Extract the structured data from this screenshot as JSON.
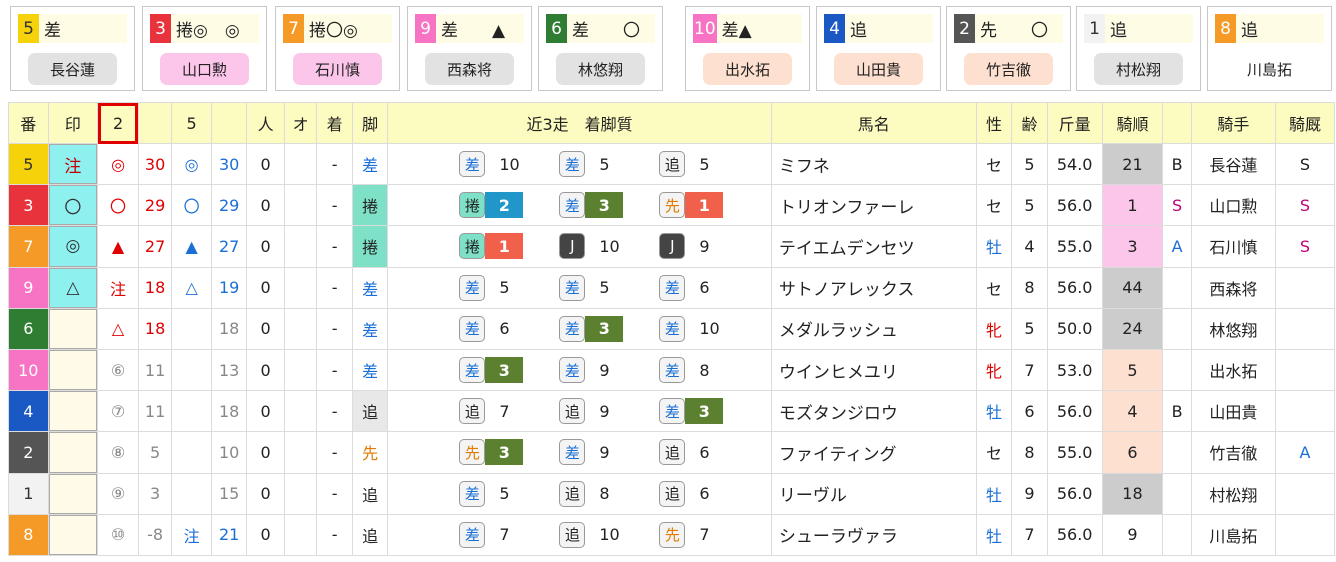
{
  "cards": [
    {
      "num": "5",
      "num_bg": "#f5d20a",
      "num_fg": "#333",
      "text": "差",
      "name": "長谷蓮",
      "name_bg": "#e2e2e2"
    },
    {
      "num": "3",
      "num_bg": "#e8333d",
      "num_fg": "#fff",
      "text": "捲◎　◎",
      "name": "山口勲",
      "name_bg": "#fcc6ea"
    },
    {
      "num": "7",
      "num_bg": "#f59a26",
      "num_fg": "#fff",
      "text": "捲〇◎",
      "name": "石川慎",
      "name_bg": "#fcc6ea"
    },
    {
      "num": "9",
      "num_bg": "#f774c4",
      "num_fg": "#fff",
      "text": "差　　▲",
      "name": "西森将",
      "name_bg": "#e2e2e2"
    },
    {
      "num": "6",
      "num_bg": "#2e7d32",
      "num_fg": "#fff",
      "text": "差　　〇",
      "name": "林悠翔",
      "name_bg": "#e2e2e2"
    },
    {
      "num": "10",
      "num_bg": "#f774c4",
      "num_fg": "#fff",
      "text": "差▲",
      "name": "出水拓",
      "name_bg": "#fde0cf"
    },
    {
      "num": "4",
      "num_bg": "#1a58c4",
      "num_fg": "#fff",
      "text": "追",
      "name": "山田貴",
      "name_bg": "#fde0cf"
    },
    {
      "num": "2",
      "num_bg": "#555555",
      "num_fg": "#fff",
      "text": "先　　〇",
      "name": "竹吉徹",
      "name_bg": "#fde0cf"
    },
    {
      "num": "1",
      "num_bg": "#f2f2f2",
      "num_fg": "#333",
      "text": "追",
      "name": "村松翔",
      "name_bg": "#e2e2e2"
    },
    {
      "num": "8",
      "num_bg": "#f59a26",
      "num_fg": "#fff",
      "text": "追",
      "name": "川島拓",
      "name_bg": "#ffffff"
    }
  ],
  "headers": [
    "番",
    "印",
    "2",
    "",
    "5",
    "",
    "人",
    "オ",
    "着",
    "脚",
    "近3走　着脚質",
    "馬名",
    "性",
    "齢",
    "斤量",
    "騎順",
    "",
    "騎手",
    "騎厩"
  ],
  "rows": [
    {
      "ban": "5",
      "ban_bg": "#f5d20a",
      "ban_fg": "#333",
      "mark": "注",
      "mark_style": "mark-cyan",
      "m2": "◎",
      "m2c": "c-red",
      "v2": "30",
      "v2c": "c-red",
      "m5": "◎",
      "m5c": "c-blue",
      "v5": "30",
      "v5c": "c-blue",
      "nin": "0",
      "o": "",
      "chaku": "-",
      "kyaku": "差",
      "kyaku_c": "c-blue",
      "kyaku_bg": "",
      "legs": [
        {
          "t": "差",
          "tc": "c-blue",
          "r": "10",
          "rbg": ""
        },
        {
          "t": "差",
          "tc": "c-blue",
          "r": "5",
          "rbg": ""
        },
        {
          "t": "追",
          "tc": "",
          "r": "5",
          "rbg": ""
        }
      ],
      "name": "ミフネ",
      "sex": "セ",
      "sexc": "",
      "age": "5",
      "kin": "54.0",
      "kijun": "21",
      "kijun_bg": "#cccccc",
      "rank": "B",
      "rankc": "",
      "kishu": "長谷蓮",
      "kyu": "S",
      "kyuc": ""
    },
    {
      "ban": "3",
      "ban_bg": "#e8333d",
      "ban_fg": "#fff",
      "mark": "〇",
      "mark_style": "mark-cyan",
      "m2": "〇",
      "m2c": "c-red",
      "v2": "29",
      "v2c": "c-red",
      "m5": "〇",
      "m5c": "c-blue",
      "v5": "29",
      "v5c": "c-blue",
      "nin": "0",
      "o": "",
      "chaku": "-",
      "kyaku": "捲",
      "kyaku_c": "",
      "kyaku_bg": "#7fe0c8",
      "legs": [
        {
          "t": "捲",
          "tc": "",
          "tbg": "#7fe0c8",
          "r": "2",
          "rbg": "#2196c8"
        },
        {
          "t": "差",
          "tc": "c-blue",
          "r": "3",
          "rbg": "#5a8030"
        },
        {
          "t": "先",
          "tc": "",
          "tcol": "#e07a00",
          "r": "1",
          "rbg": "#f0604a"
        }
      ],
      "name": "トリオンファーレ",
      "sex": "セ",
      "sexc": "",
      "age": "5",
      "kin": "56.0",
      "kijun": "1",
      "kijun_bg": "#fcc6ea",
      "rank": "S",
      "rankc": "c-mag",
      "kishu": "山口勲",
      "kyu": "S",
      "kyuc": "c-mag"
    },
    {
      "ban": "7",
      "ban_bg": "#f59a26",
      "ban_fg": "#fff",
      "mark": "◎",
      "mark_style": "mark-cyan",
      "m2": "▲",
      "m2c": "c-red",
      "v2": "27",
      "v2c": "c-red",
      "m5": "▲",
      "m5c": "c-blue",
      "v5": "27",
      "v5c": "c-blue",
      "nin": "0",
      "o": "",
      "chaku": "-",
      "kyaku": "捲",
      "kyaku_c": "",
      "kyaku_bg": "#7fe0c8",
      "legs": [
        {
          "t": "捲",
          "tc": "",
          "tbg": "#7fe0c8",
          "r": "1",
          "rbg": "#f0604a"
        },
        {
          "t": "J",
          "tc": "",
          "tbg": "#444",
          "tcol": "#fff",
          "r": "10",
          "rbg": ""
        },
        {
          "t": "J",
          "tc": "",
          "tbg": "#444",
          "tcol": "#fff",
          "r": "9",
          "rbg": ""
        }
      ],
      "name": "テイエムデンセツ",
      "sex": "牡",
      "sexc": "c-blue",
      "age": "4",
      "kin": "55.0",
      "kijun": "3",
      "kijun_bg": "#fcc6ea",
      "rank": "A",
      "rankc": "c-blue",
      "kishu": "石川慎",
      "kyu": "S",
      "kyuc": "c-mag"
    },
    {
      "ban": "9",
      "ban_bg": "#f774c4",
      "ban_fg": "#fff",
      "mark": "△",
      "mark_style": "mark-cyan",
      "m2": "注",
      "m2c": "c-red",
      "v2": "18",
      "v2c": "c-red",
      "m5": "△",
      "m5c": "c-blue",
      "v5": "19",
      "v5c": "c-blue",
      "nin": "0",
      "o": "",
      "chaku": "-",
      "kyaku": "差",
      "kyaku_c": "c-blue",
      "kyaku_bg": "",
      "legs": [
        {
          "t": "差",
          "tc": "c-blue",
          "r": "5",
          "rbg": ""
        },
        {
          "t": "差",
          "tc": "c-blue",
          "r": "5",
          "rbg": ""
        },
        {
          "t": "差",
          "tc": "c-blue",
          "r": "6",
          "rbg": ""
        }
      ],
      "name": "サトノアレックス",
      "sex": "セ",
      "sexc": "",
      "age": "8",
      "kin": "56.0",
      "kijun": "44",
      "kijun_bg": "#cccccc",
      "rank": "",
      "rankc": "",
      "kishu": "西森将",
      "kyu": "",
      "kyuc": ""
    },
    {
      "ban": "6",
      "ban_bg": "#2e7d32",
      "ban_fg": "#fff",
      "mark": "",
      "mark_style": "mark-cream",
      "m2": "△",
      "m2c": "c-red",
      "v2": "18",
      "v2c": "c-red",
      "m5": "",
      "m5c": "",
      "v5": "18",
      "v5c": "c-gray",
      "nin": "0",
      "o": "",
      "chaku": "-",
      "kyaku": "差",
      "kyaku_c": "c-blue",
      "kyaku_bg": "",
      "legs": [
        {
          "t": "差",
          "tc": "c-blue",
          "r": "6",
          "rbg": ""
        },
        {
          "t": "差",
          "tc": "c-blue",
          "r": "3",
          "rbg": "#5a8030"
        },
        {
          "t": "差",
          "tc": "c-blue",
          "r": "10",
          "rbg": ""
        }
      ],
      "name": "メダルラッシュ",
      "sex": "牝",
      "sexc": "c-red",
      "age": "5",
      "kin": "50.0",
      "kijun": "24",
      "kijun_bg": "#cccccc",
      "rank": "",
      "rankc": "",
      "kishu": "林悠翔",
      "kyu": "",
      "kyuc": ""
    },
    {
      "ban": "10",
      "ban_bg": "#f774c4",
      "ban_fg": "#fff",
      "mark": "",
      "mark_style": "mark-cream",
      "m2": "⑥",
      "m2c": "c-gray",
      "v2": "11",
      "v2c": "c-gray",
      "m5": "",
      "m5c": "",
      "v5": "13",
      "v5c": "c-gray",
      "nin": "0",
      "o": "",
      "chaku": "-",
      "kyaku": "差",
      "kyaku_c": "c-blue",
      "kyaku_bg": "",
      "legs": [
        {
          "t": "差",
          "tc": "c-blue",
          "r": "3",
          "rbg": "#5a8030"
        },
        {
          "t": "差",
          "tc": "c-blue",
          "r": "9",
          "rbg": ""
        },
        {
          "t": "差",
          "tc": "c-blue",
          "r": "8",
          "rbg": ""
        }
      ],
      "name": "ウインヒメユリ",
      "sex": "牝",
      "sexc": "c-red",
      "age": "7",
      "kin": "53.0",
      "kijun": "5",
      "kijun_bg": "#fde0cf",
      "rank": "",
      "rankc": "",
      "kishu": "出水拓",
      "kyu": "",
      "kyuc": ""
    },
    {
      "ban": "4",
      "ban_bg": "#1a58c4",
      "ban_fg": "#fff",
      "mark": "",
      "mark_style": "mark-cream",
      "m2": "⑦",
      "m2c": "c-gray",
      "v2": "11",
      "v2c": "c-gray",
      "m5": "",
      "m5c": "",
      "v5": "18",
      "v5c": "c-gray",
      "nin": "0",
      "o": "",
      "chaku": "-",
      "kyaku": "追",
      "kyaku_c": "",
      "kyaku_bg": "#e8e8e8",
      "legs": [
        {
          "t": "追",
          "tc": "",
          "r": "7",
          "rbg": ""
        },
        {
          "t": "追",
          "tc": "",
          "r": "9",
          "rbg": ""
        },
        {
          "t": "差",
          "tc": "c-blue",
          "r": "3",
          "rbg": "#5a8030"
        }
      ],
      "name": "モズタンジロウ",
      "sex": "牡",
      "sexc": "c-blue",
      "age": "6",
      "kin": "56.0",
      "kijun": "4",
      "kijun_bg": "#fde0cf",
      "rank": "B",
      "rankc": "",
      "kishu": "山田貴",
      "kyu": "",
      "kyuc": ""
    },
    {
      "ban": "2",
      "ban_bg": "#555555",
      "ban_fg": "#fff",
      "mark": "",
      "mark_style": "mark-cream",
      "m2": "⑧",
      "m2c": "c-gray",
      "v2": "5",
      "v2c": "c-gray",
      "m5": "",
      "m5c": "",
      "v5": "10",
      "v5c": "c-gray",
      "nin": "0",
      "o": "",
      "chaku": "-",
      "kyaku": "先",
      "kyaku_c": "",
      "kyaku_col": "#e07a00",
      "kyaku_bg": "",
      "legs": [
        {
          "t": "先",
          "tc": "",
          "tcol": "#e07a00",
          "r": "3",
          "rbg": "#5a8030"
        },
        {
          "t": "差",
          "tc": "c-blue",
          "r": "9",
          "rbg": ""
        },
        {
          "t": "追",
          "tc": "",
          "r": "6",
          "rbg": ""
        }
      ],
      "name": "ファイティング",
      "sex": "セ",
      "sexc": "",
      "age": "8",
      "kin": "55.0",
      "kijun": "6",
      "kijun_bg": "#fde0cf",
      "rank": "",
      "rankc": "",
      "kishu": "竹吉徹",
      "kyu": "A",
      "kyuc": "c-blue"
    },
    {
      "ban": "1",
      "ban_bg": "#f2f2f2",
      "ban_fg": "#333",
      "mark": "",
      "mark_style": "mark-cream",
      "m2": "⑨",
      "m2c": "c-gray",
      "v2": "3",
      "v2c": "c-gray",
      "m5": "",
      "m5c": "",
      "v5": "15",
      "v5c": "c-gray",
      "nin": "0",
      "o": "",
      "chaku": "-",
      "kyaku": "追",
      "kyaku_c": "",
      "kyaku_bg": "",
      "legs": [
        {
          "t": "差",
          "tc": "c-blue",
          "r": "5",
          "rbg": ""
        },
        {
          "t": "追",
          "tc": "",
          "r": "8",
          "rbg": ""
        },
        {
          "t": "追",
          "tc": "",
          "r": "6",
          "rbg": ""
        }
      ],
      "name": "リーヴル",
      "sex": "牡",
      "sexc": "c-blue",
      "age": "9",
      "kin": "56.0",
      "kijun": "18",
      "kijun_bg": "#cccccc",
      "rank": "",
      "rankc": "",
      "kishu": "村松翔",
      "kyu": "",
      "kyuc": ""
    },
    {
      "ban": "8",
      "ban_bg": "#f59a26",
      "ban_fg": "#fff",
      "mark": "",
      "mark_style": "mark-cream",
      "m2": "⑩",
      "m2c": "c-gray",
      "v2": "-8",
      "v2c": "c-gray",
      "m5": "注",
      "m5c": "c-blue",
      "v5": "21",
      "v5c": "c-blue",
      "nin": "0",
      "o": "",
      "chaku": "-",
      "kyaku": "追",
      "kyaku_c": "",
      "kyaku_bg": "",
      "legs": [
        {
          "t": "差",
          "tc": "c-blue",
          "r": "7",
          "rbg": ""
        },
        {
          "t": "追",
          "tc": "",
          "r": "10",
          "rbg": ""
        },
        {
          "t": "先",
          "tc": "",
          "tcol": "#e07a00",
          "r": "7",
          "rbg": ""
        }
      ],
      "name": "シューラヴァラ",
      "sex": "牡",
      "sexc": "c-blue",
      "age": "7",
      "kin": "56.0",
      "kijun": "9",
      "kijun_bg": "#ffffff",
      "rank": "",
      "rankc": "",
      "kishu": "川島拓",
      "kyu": "",
      "kyuc": ""
    }
  ]
}
